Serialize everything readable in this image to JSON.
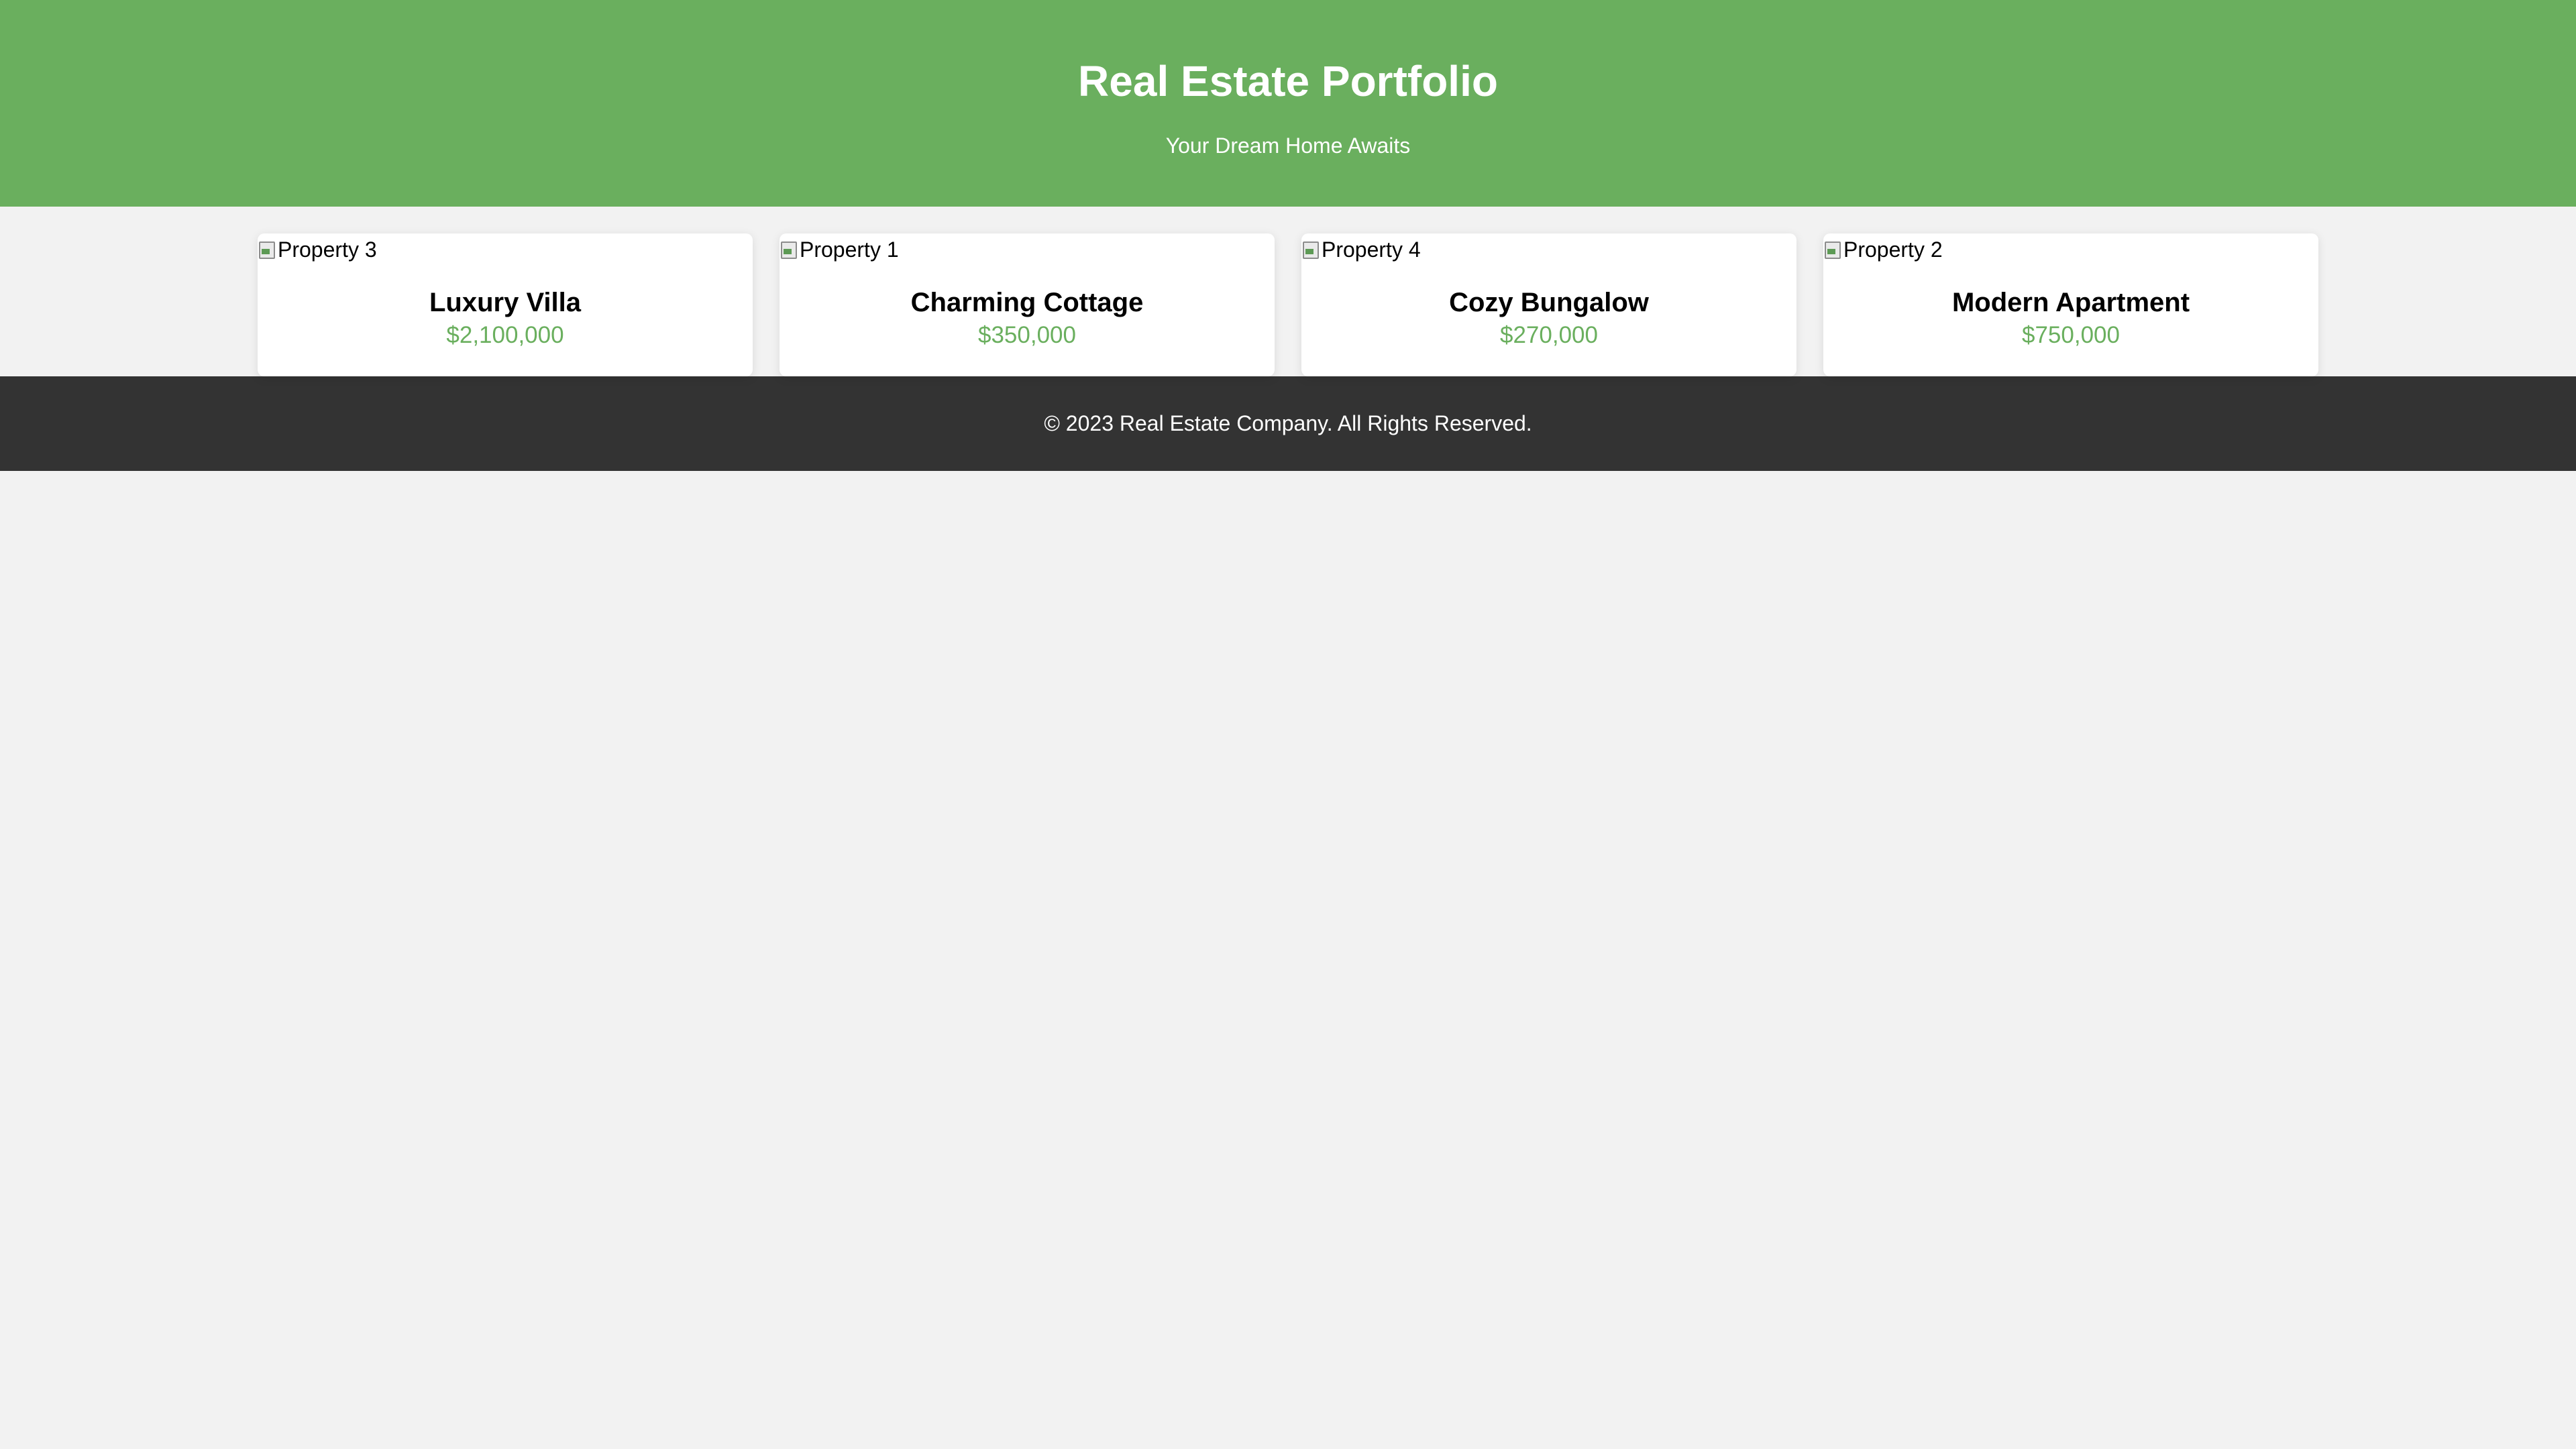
{
  "header": {
    "title": "Real Estate Portfolio",
    "subtitle": "Your Dream Home Awaits"
  },
  "properties": [
    {
      "image_alt": "Property 3",
      "name": "Luxury Villa",
      "price": "$2,100,000"
    },
    {
      "image_alt": "Property 1",
      "name": "Charming Cottage",
      "price": "$350,000"
    },
    {
      "image_alt": "Property 4",
      "name": "Cozy Bungalow",
      "price": "$270,000"
    },
    {
      "image_alt": "Property 2",
      "name": "Modern Apartment",
      "price": "$750,000"
    }
  ],
  "footer": {
    "text": "© 2023 Real Estate Company. All Rights Reserved."
  },
  "colors": {
    "header_background": "#6aaf5e",
    "price_text": "#6aaf5e",
    "footer_background": "#333333",
    "page_background": "#f2f2f2"
  },
  "icons": {
    "broken_image": "broken-image-icon"
  }
}
